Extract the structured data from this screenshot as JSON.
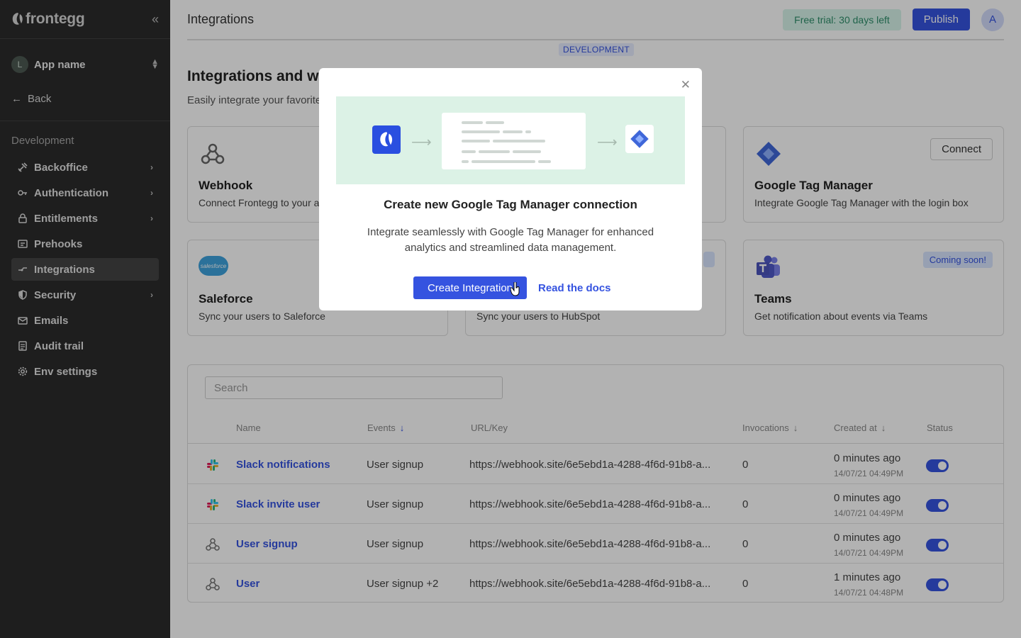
{
  "sidebar": {
    "logo_text": "frontegg",
    "collapse_icon": "double-chevron-left-icon",
    "app": {
      "avatar_letter": "L",
      "name": "App name"
    },
    "back_label": "Back",
    "env_label": "Development",
    "items": [
      {
        "label": "Backoffice",
        "icon": "tools-icon",
        "chevron": true,
        "active": false
      },
      {
        "label": "Authentication",
        "icon": "key-icon",
        "chevron": true,
        "active": false
      },
      {
        "label": "Entitlements",
        "icon": "lock-icon",
        "chevron": true,
        "active": false
      },
      {
        "label": "Prehooks",
        "icon": "prehooks-icon",
        "chevron": false,
        "active": false
      },
      {
        "label": "Integrations",
        "icon": "integrations-icon",
        "chevron": false,
        "active": true
      },
      {
        "label": "Security",
        "icon": "shield-icon",
        "chevron": true,
        "active": false
      },
      {
        "label": "Emails",
        "icon": "mail-icon",
        "chevron": false,
        "active": false
      },
      {
        "label": "Audit trail",
        "icon": "list-icon",
        "chevron": false,
        "active": false
      },
      {
        "label": "Env settings",
        "icon": "gear-icon",
        "chevron": false,
        "active": false
      }
    ]
  },
  "header": {
    "title": "Integrations",
    "trial_badge": "Free trial: 30 days left",
    "publish_label": "Publish",
    "user_avatar": "A",
    "env_badge": "DEVELOPMENT"
  },
  "section": {
    "title": "Integrations and we",
    "subtitle": "Easily integrate your favorite"
  },
  "cards": [
    {
      "title": "Webhook",
      "desc": "Connect Frontegg to your a",
      "icon": "webhook-icon"
    },
    {
      "title": "Google Tag Manager",
      "desc": "Integrate Google Tag Manager with the login box",
      "icon": "gtm-icon",
      "action": "Connect"
    },
    {
      "title": "Saleforce",
      "desc": "Sync your users to Saleforce",
      "icon": "salesforce-icon",
      "icon_text": "salesforce"
    },
    {
      "title": "",
      "desc": "Sync your users to HubSpot",
      "icon": "hubspot-icon"
    },
    {
      "title": "Teams",
      "desc": "Get notification about events via Teams",
      "icon": "teams-icon",
      "badge": "Coming soon!"
    }
  ],
  "table": {
    "search_placeholder": "Search",
    "columns": [
      "Name",
      "Events",
      "URL/Key",
      "Invocations",
      "Created at",
      "Status"
    ],
    "rows": [
      {
        "icon": "slack-icon",
        "name": "Slack notifications",
        "events": "User signup",
        "url": "https://webhook.site/6e5ebd1a-4288-4f6d-91b8-a...",
        "invocations": "0",
        "created": "0 minutes ago",
        "date": "14/07/21 04:49PM",
        "status": true
      },
      {
        "icon": "slack-icon",
        "name": "Slack invite user",
        "events": "User signup",
        "url": "https://webhook.site/6e5ebd1a-4288-4f6d-91b8-a...",
        "invocations": "0",
        "created": "0 minutes ago",
        "date": "14/07/21 04:49PM",
        "status": true
      },
      {
        "icon": "webhook-icon",
        "name": "User signup",
        "events": "User signup",
        "url": "https://webhook.site/6e5ebd1a-4288-4f6d-91b8-a...",
        "invocations": "0",
        "created": "0 minutes ago",
        "date": "14/07/21 04:49PM",
        "status": true
      },
      {
        "icon": "webhook-icon",
        "name": "User",
        "events": "User signup +2",
        "url": "https://webhook.site/6e5ebd1a-4288-4f6d-91b8-a...",
        "invocations": "0",
        "created": "1 minutes ago",
        "date": "14/07/21 04:48PM",
        "status": true
      }
    ]
  },
  "modal": {
    "title": "Create new Google Tag Manager connection",
    "description": "Integrate seamlessly with Google Tag Manager for enhanced analytics and streamlined data management.",
    "primary_label": "Create Integration",
    "link_label": "Read the docs",
    "close_icon": "close-icon"
  },
  "colors": {
    "accent": "#3553e0",
    "sidebar_bg": "#2b2b2b",
    "hero_bg": "#dcf2e6",
    "trial_bg": "#d7f4ea"
  }
}
